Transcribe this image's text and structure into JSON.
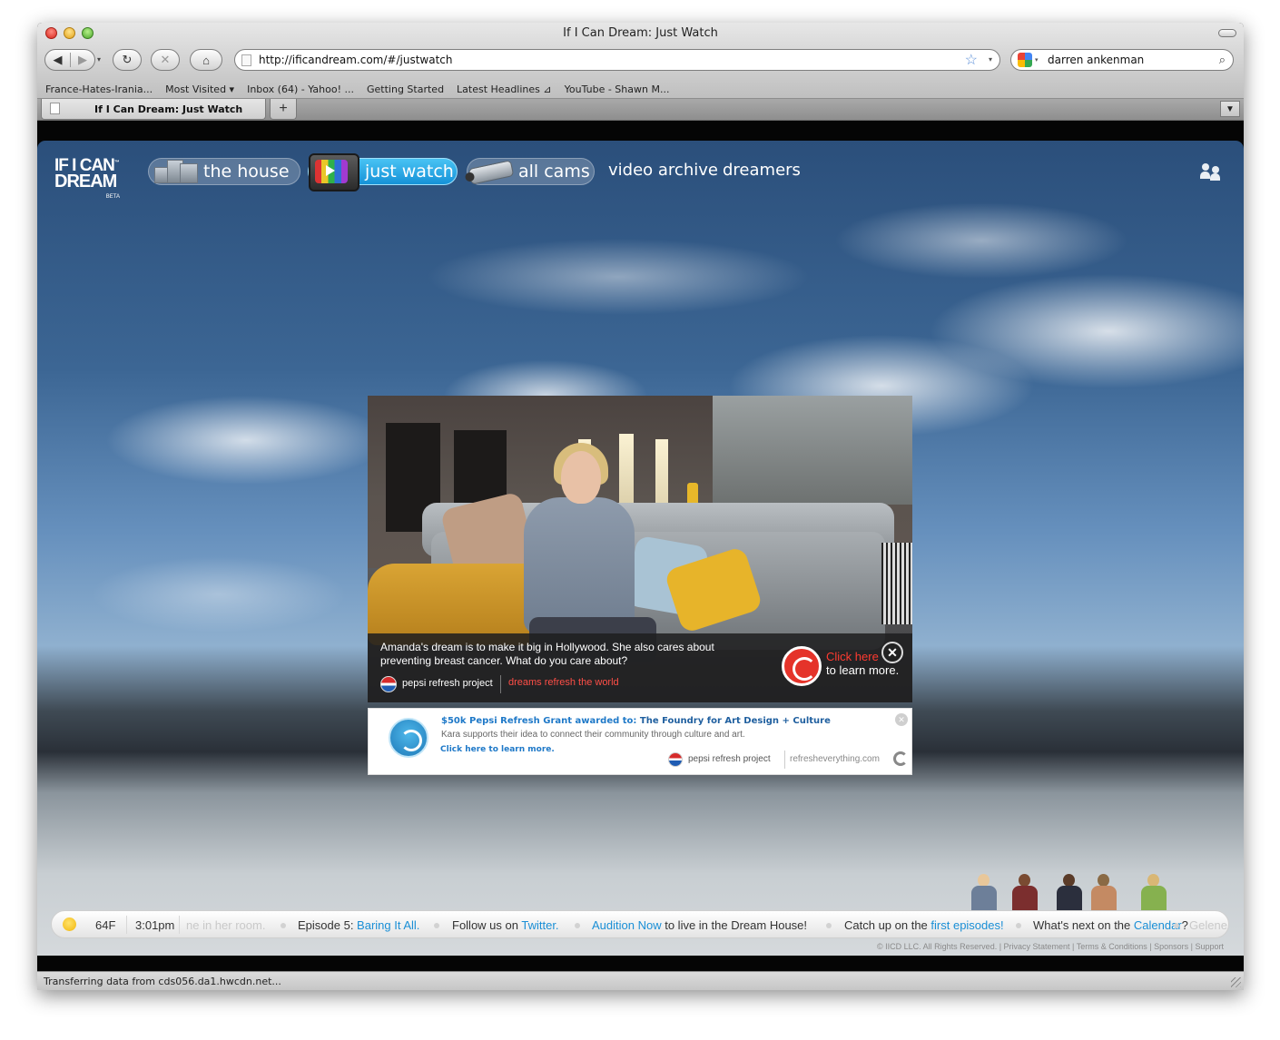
{
  "window": {
    "title": "If I Can Dream: Just Watch"
  },
  "toolbar": {
    "back_icon": "◀",
    "forward_icon": "▶",
    "dropdown_icon": "▾",
    "reload_icon": "↻",
    "stop_icon": "✕",
    "home_icon": "⌂",
    "url": "http://ificandream.com/#/justwatch",
    "bookmark_star_icon": "☆",
    "url_dropdown_icon": "▾",
    "search_value": "darren ankenman",
    "search_icon": "⌕"
  },
  "bookmarks": [
    "France-Hates-Irania...",
    "Most Visited ▾",
    "Inbox (64) - Yahoo! ...",
    "Getting Started",
    "Latest Headlines ⊿",
    "YouTube - Shawn M..."
  ],
  "tabs": {
    "active_label": "If I Can Dream: Just Watch",
    "new_tab_label": "+",
    "list_icon": "▼"
  },
  "site": {
    "logo_line1": "IF I CAN",
    "logo_line2": "DREAM",
    "logo_tm": "™",
    "logo_beta": "BETA",
    "nav": {
      "house": "the house",
      "just_watch": "just watch",
      "all_cams": "all cams",
      "video_archive": "video archive",
      "dreamers": "dreamers"
    }
  },
  "player": {
    "caption": "Amanda's dream is to make it big in Hollywood. She also cares about preventing breast cancer. What do you care about?",
    "sponsor": "pepsi refresh project",
    "tagline": "dreams refresh the world",
    "cta_click": "Click here",
    "cta_learn": "to learn more.",
    "close_label": "✕"
  },
  "banner": {
    "prize": "$50k Pepsi Refresh Grant awarded to:",
    "winner": "The Foundry for Art Design + Culture",
    "description": "Kara supports their idea to connect their community through culture and art.",
    "link": "Click here to learn more.",
    "sponsor": "pepsi refresh project",
    "site": "refresheverything.com",
    "close_label": "✕"
  },
  "ticker": {
    "temperature": "64F",
    "time": "3:01pm",
    "status_fragment": "ne in her room.",
    "episode_prefix": "Episode 5: ",
    "episode_link": "Baring It All.",
    "follow_prefix": "Follow us on ",
    "follow_link": "Twitter.",
    "audition_link": "Audition Now",
    "audition_suffix": " to live in the Dream House!",
    "catchup_prefix": "Catch up on the ",
    "catchup_link": "first episodes!",
    "whats_next_prefix": "What's next ",
    "whats_next_on": "on the ",
    "calendar_link": "Calendar",
    "whats_next_suffix": "?",
    "trailing": "Gelene"
  },
  "footer": {
    "text": "© IICD LLC. All Rights Reserved. | Privacy Statement | Terms & Conditions | Sponsors | Support"
  },
  "status": {
    "text": "Transferring data from cds056.da1.hwcdn.net..."
  }
}
